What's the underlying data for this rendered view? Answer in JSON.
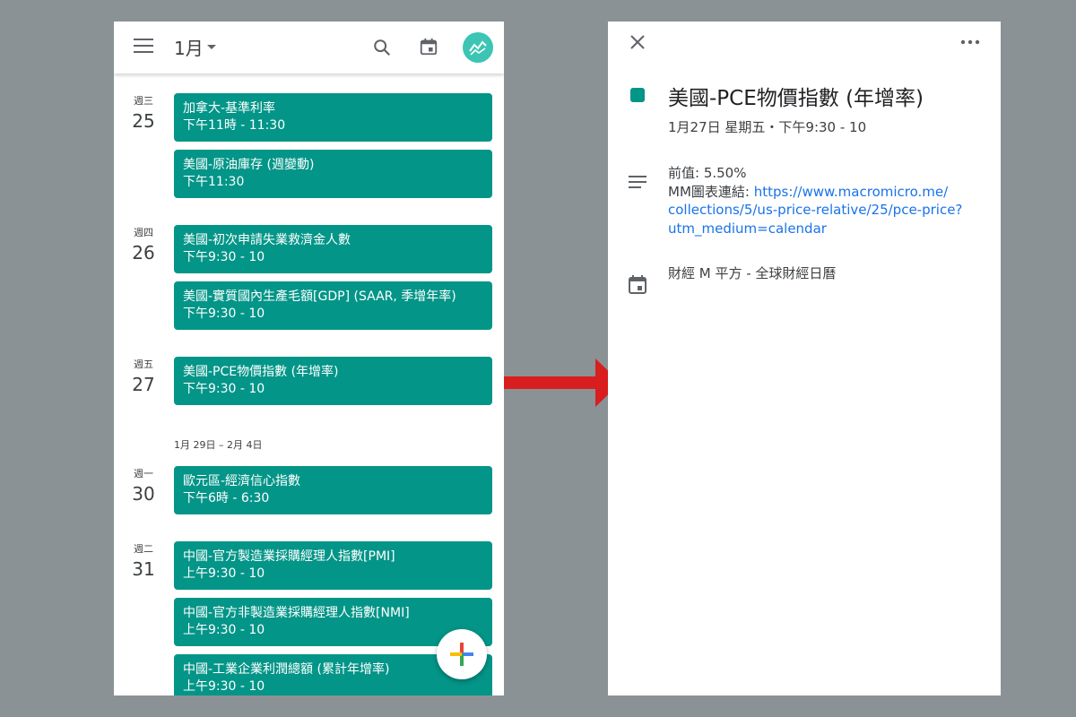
{
  "calendar_list": {
    "header": {
      "month_label": "1月",
      "icons": [
        "menu-icon",
        "search-icon",
        "calendar-today-icon",
        "trend-avatar-icon"
      ]
    },
    "week_range_label": "1月 29日 – 2月 4日",
    "days": [
      {
        "weekday": "週三",
        "date": "25",
        "events": [
          {
            "title": "加拿大-基準利率",
            "time": "下午11時 - 11:30"
          },
          {
            "title": "美國-原油庫存 (週變動)",
            "time": "下午11:30"
          }
        ]
      },
      {
        "weekday": "週四",
        "date": "26",
        "events": [
          {
            "title": "美國-初次申請失業救濟金人數",
            "time": "下午9:30 - 10"
          },
          {
            "title": "美國-實質國內生產毛額[GDP] (SAAR, 季增年率)",
            "time": "下午9:30 - 10"
          }
        ]
      },
      {
        "weekday": "週五",
        "date": "27",
        "events": [
          {
            "title": "美國-PCE物價指數 (年增率)",
            "time": "下午9:30 - 10"
          }
        ]
      },
      {
        "weekday": "週一",
        "date": "30",
        "events": [
          {
            "title": "歐元區-經濟信心指數",
            "time": "下午6時 - 6:30"
          }
        ]
      },
      {
        "weekday": "週二",
        "date": "31",
        "events": [
          {
            "title": "中國-官方製造業採購經理人指數[PMI]",
            "time": "上午9:30 - 10"
          },
          {
            "title": "中國-官方非製造業採購經理人指數[NMI]",
            "time": "上午9:30 - 10"
          },
          {
            "title": "中國-工業企業利潤總額 (累計年增率)",
            "time": "上午9:30 - 10"
          }
        ]
      }
    ],
    "fab_icon": "plus-icon",
    "event_color": "#039588"
  },
  "arrow_color": "#d81e1e",
  "event_detail": {
    "title": "美國-PCE物價指數 (年增率)",
    "datetime": "1月27日 星期五・下午9:30 - 10",
    "description": {
      "previous_label": "前值: 5.50%",
      "chart_link_label": "MM圖表連結: ",
      "chart_link_url_1": "https://www.macromicro.me/",
      "chart_link_url_2": "collections/5/us-price-relative/25/pce-price?",
      "chart_link_url_3": "utm_medium=calendar"
    },
    "calendar_name": "財經 M 平方 - 全球財經日曆",
    "icons": [
      "close-icon",
      "more-icon",
      "notes-icon",
      "calendar-icon"
    ]
  }
}
